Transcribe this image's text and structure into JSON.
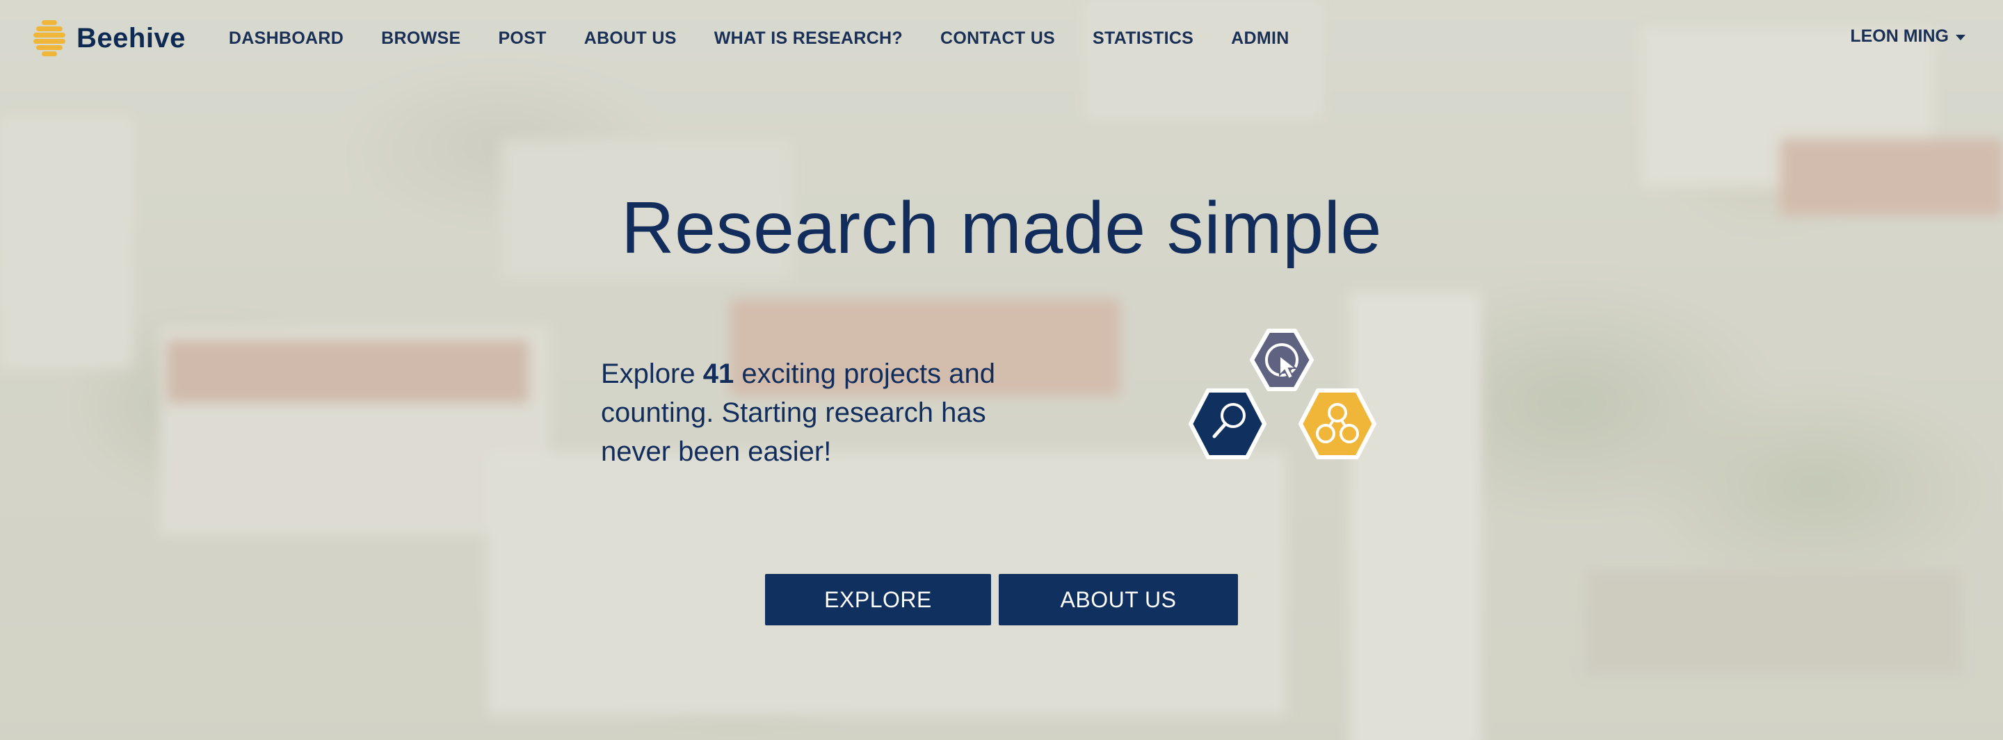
{
  "brand": {
    "name": "Beehive",
    "logo_icon": "honeycomb-logo-icon",
    "logo_color": "#f0b63a"
  },
  "nav": {
    "items": [
      {
        "label": "DASHBOARD"
      },
      {
        "label": "BROWSE"
      },
      {
        "label": "POST"
      },
      {
        "label": "ABOUT US"
      },
      {
        "label": "WHAT IS RESEARCH?"
      },
      {
        "label": "CONTACT US"
      },
      {
        "label": "STATISTICS"
      },
      {
        "label": "ADMIN"
      }
    ],
    "user": {
      "name": "LEON MING",
      "dropdown_icon": "caret-down-icon"
    }
  },
  "hero": {
    "title": "Research made simple",
    "text_prefix": "Explore ",
    "project_count": "41",
    "text_suffix": " exciting projects and counting. Starting research has never been easier!",
    "hexagons": [
      {
        "icon": "cursor-click-icon",
        "color": "#5f6381"
      },
      {
        "icon": "search-icon",
        "color": "#10305f"
      },
      {
        "icon": "network-icon",
        "color": "#f0b63a"
      }
    ]
  },
  "actions": {
    "explore_label": "EXPLORE",
    "about_label": "ABOUT US"
  },
  "colors": {
    "primary": "#10305f",
    "accent": "#f0b63a",
    "muted": "#5f6381"
  }
}
